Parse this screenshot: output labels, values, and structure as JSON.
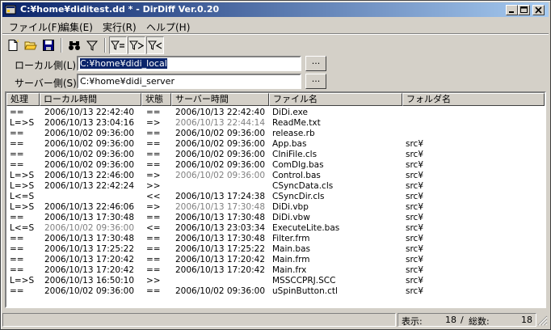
{
  "window": {
    "title": "C:¥home¥diditest.dd * - DirDiff Ver.0.20"
  },
  "menu": [
    "ファイル(F)",
    "編集(E)",
    "実行(R)",
    "ヘルプ(H)"
  ],
  "toolbar": {
    "icons": [
      "new-file-icon",
      "open-folder-icon",
      "save-icon",
      "binoculars-icon",
      "filter-icon",
      "filter-equal-icon",
      "filter-right-icon",
      "filter-left-icon"
    ]
  },
  "paths": {
    "local_label": "ローカル側(L):",
    "local_value": "C:¥home¥didi_local",
    "server_label": "サーバー側(S):",
    "server_value": "C:¥home¥didi_server",
    "browse_label": "..."
  },
  "columns": [
    "処理",
    "ローカル時間",
    "状態",
    "サーバー時間",
    "ファイル名",
    "フォルダ名"
  ],
  "rows": [
    {
      "action": "==",
      "local": "2006/10/13 22:42:40",
      "state": "==",
      "server": "2006/10/13 22:42:40",
      "file": "DiDi.exe",
      "folder": "",
      "lg": false,
      "sg": false
    },
    {
      "action": "L=>S",
      "local": "2006/10/13 23:04:16",
      "state": "=>",
      "server": "2006/10/13 22:44:14",
      "file": "ReadMe.txt",
      "folder": "",
      "lg": false,
      "sg": true
    },
    {
      "action": "==",
      "local": "2006/10/02 09:36:00",
      "state": "==",
      "server": "2006/10/02 09:36:00",
      "file": "release.rb",
      "folder": "",
      "lg": false,
      "sg": false
    },
    {
      "action": "==",
      "local": "2006/10/02 09:36:00",
      "state": "==",
      "server": "2006/10/02 09:36:00",
      "file": "App.bas",
      "folder": "src¥",
      "lg": false,
      "sg": false
    },
    {
      "action": "==",
      "local": "2006/10/02 09:36:00",
      "state": "==",
      "server": "2006/10/02 09:36:00",
      "file": "CIniFile.cls",
      "folder": "src¥",
      "lg": false,
      "sg": false
    },
    {
      "action": "==",
      "local": "2006/10/02 09:36:00",
      "state": "==",
      "server": "2006/10/02 09:36:00",
      "file": "ComDlg.bas",
      "folder": "src¥",
      "lg": false,
      "sg": false
    },
    {
      "action": "L=>S",
      "local": "2006/10/13 22:46:00",
      "state": "=>",
      "server": "2006/10/02 09:36:00",
      "file": "Control.bas",
      "folder": "src¥",
      "lg": false,
      "sg": true
    },
    {
      "action": "L=>S",
      "local": "2006/10/13 22:42:24",
      "state": ">>",
      "server": "",
      "file": "CSyncData.cls",
      "folder": "src¥",
      "lg": false,
      "sg": false
    },
    {
      "action": "L<=S",
      "local": "",
      "state": "<<",
      "server": "2006/10/13 17:24:38",
      "file": "CSyncDir.cls",
      "folder": "src¥",
      "lg": false,
      "sg": false
    },
    {
      "action": "L=>S",
      "local": "2006/10/13 22:46:06",
      "state": "=>",
      "server": "2006/10/13 17:30:48",
      "file": "DiDi.vbp",
      "folder": "src¥",
      "lg": false,
      "sg": true
    },
    {
      "action": "==",
      "local": "2006/10/13 17:30:48",
      "state": "==",
      "server": "2006/10/13 17:30:48",
      "file": "DiDi.vbw",
      "folder": "src¥",
      "lg": false,
      "sg": false
    },
    {
      "action": "L<=S",
      "local": "2006/10/02 09:36:00",
      "state": "<=",
      "server": "2006/10/13 23:03:34",
      "file": "ExecuteLite.bas",
      "folder": "src¥",
      "lg": true,
      "sg": false
    },
    {
      "action": "==",
      "local": "2006/10/13 17:30:48",
      "state": "==",
      "server": "2006/10/13 17:30:48",
      "file": "Filter.frm",
      "folder": "src¥",
      "lg": false,
      "sg": false
    },
    {
      "action": "==",
      "local": "2006/10/13 17:25:22",
      "state": "==",
      "server": "2006/10/13 17:25:22",
      "file": "Main.bas",
      "folder": "src¥",
      "lg": false,
      "sg": false
    },
    {
      "action": "==",
      "local": "2006/10/13 17:20:42",
      "state": "==",
      "server": "2006/10/13 17:20:42",
      "file": "Main.frm",
      "folder": "src¥",
      "lg": false,
      "sg": false
    },
    {
      "action": "==",
      "local": "2006/10/13 17:20:42",
      "state": "==",
      "server": "2006/10/13 17:20:42",
      "file": "Main.frx",
      "folder": "src¥",
      "lg": false,
      "sg": false
    },
    {
      "action": "L=>S",
      "local": "2006/10/13 16:50:10",
      "state": ">>",
      "server": "",
      "file": "MSSCCPRJ.SCC",
      "folder": "src¥",
      "lg": false,
      "sg": false
    },
    {
      "action": "==",
      "local": "2006/10/02 09:36:00",
      "state": "==",
      "server": "2006/10/02 09:36:00",
      "file": "uSpinButton.ctl",
      "folder": "src¥",
      "lg": false,
      "sg": false
    }
  ],
  "status": {
    "display_label": "表示:",
    "display_count": "18",
    "separator": "/",
    "total_label": "総数:",
    "total_count": "18"
  },
  "colors": {
    "titlebar_start": "#0a246a",
    "titlebar_end": "#a6caf0",
    "selection": "#0a246a",
    "gray_text": "#808080"
  }
}
